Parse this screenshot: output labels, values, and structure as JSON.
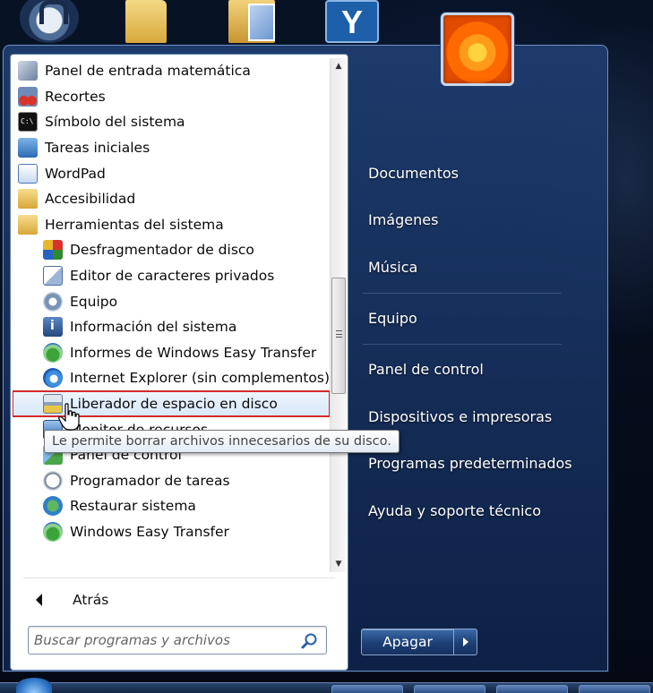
{
  "programs": [
    {
      "label": "Panel de entrada matemática",
      "icon": "math-input-icon",
      "level": 0
    },
    {
      "label": "Recortes",
      "icon": "scissors-icon",
      "level": 0
    },
    {
      "label": "Símbolo del sistema",
      "icon": "command-prompt-icon",
      "level": 0
    },
    {
      "label": "Tareas iniciales",
      "icon": "getting-started-icon",
      "level": 0
    },
    {
      "label": "WordPad",
      "icon": "wordpad-icon",
      "level": 0
    },
    {
      "label": "Accesibilidad",
      "icon": "folder-icon",
      "level": 0
    },
    {
      "label": "Herramientas del sistema",
      "icon": "folder-icon",
      "level": 0
    },
    {
      "label": "Desfragmentador de disco",
      "icon": "defrag-icon",
      "level": 1
    },
    {
      "label": "Editor de caracteres privados",
      "icon": "char-editor-icon",
      "level": 1
    },
    {
      "label": "Equipo",
      "icon": "computer-icon",
      "level": 1
    },
    {
      "label": "Información del sistema",
      "icon": "system-info-icon",
      "level": 1
    },
    {
      "label": "Informes de Windows Easy Transfer",
      "icon": "easy-transfer-reports-icon",
      "level": 1
    },
    {
      "label": "Internet Explorer (sin complementos)",
      "icon": "internet-explorer-icon",
      "level": 1
    },
    {
      "label": "Liberador de espacio en disco",
      "icon": "disk-cleanup-icon",
      "level": 1,
      "highlighted": true
    },
    {
      "label": "Monitor de recursos",
      "icon": "resource-monitor-icon",
      "level": 1
    },
    {
      "label": "Panel de control",
      "icon": "control-panel-icon",
      "level": 1
    },
    {
      "label": "Programador de tareas",
      "icon": "task-scheduler-icon",
      "level": 1
    },
    {
      "label": "Restaurar sistema",
      "icon": "system-restore-icon",
      "level": 1
    },
    {
      "label": "Windows Easy Transfer",
      "icon": "easy-transfer-icon",
      "level": 1
    }
  ],
  "tooltip": "Le permite borrar archivos innecesarios de su disco.",
  "back_label": "Atrás",
  "search": {
    "placeholder": "Buscar programas y archivos"
  },
  "right_pane": {
    "documents": "Documentos",
    "pictures": "Imágenes",
    "music": "Música",
    "computer": "Equipo",
    "control_panel": "Panel de control",
    "devices": "Dispositivos e impresoras",
    "default_programs": "Programas predeterminados",
    "help": "Ayuda y soporte técnico"
  },
  "shutdown_label": "Apagar",
  "colors": {
    "highlight_border": "#d42a2a",
    "menu_blue": "#1c3f75",
    "white": "#ffffff"
  }
}
